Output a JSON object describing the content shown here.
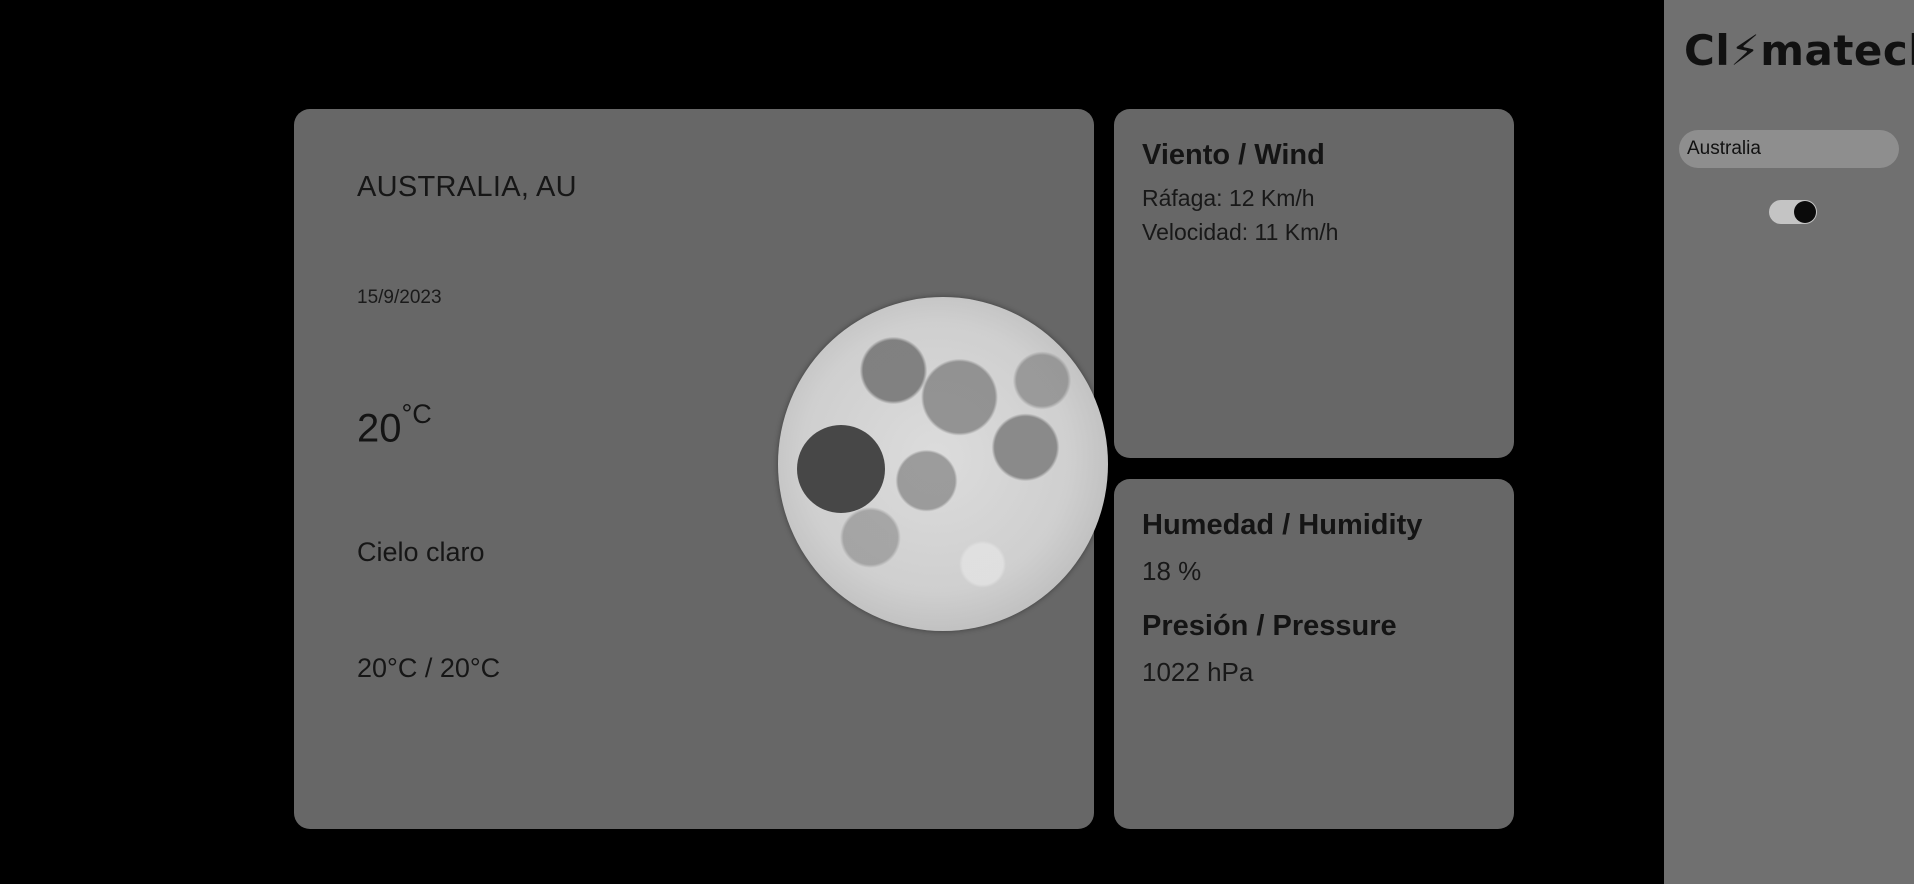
{
  "main": {
    "city": "AUSTRALIA, AU",
    "date": "15/9/2023",
    "temp_value": "20",
    "temp_unit": "°C",
    "condition": "Cielo claro",
    "temp_range": "20°C / 20°C",
    "weather_icon": "moon-icon"
  },
  "wind": {
    "title": "Viento / Wind",
    "gust": "Ráfaga: 12 Km/h",
    "speed": "Velocidad: 11 Km/h"
  },
  "humidity": {
    "title": "Humedad / Humidity",
    "value": "18 %",
    "pressure_title": "Presión / Pressure",
    "pressure_value": "1022 hPa"
  },
  "sidebar": {
    "logo": "Cl⚡matech",
    "search_value": "Australia",
    "toggle_state": "on"
  },
  "colors": {
    "background": "#000000",
    "card": "#707070",
    "sidebar": "#707070",
    "text": "#141414"
  }
}
